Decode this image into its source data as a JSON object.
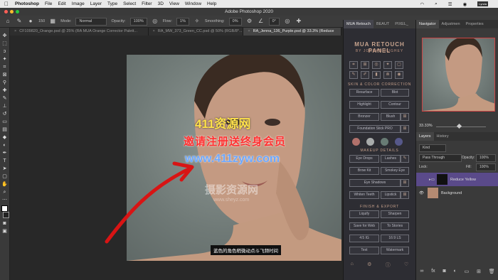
{
  "menubar": {
    "apple": "",
    "app": "Photoshop",
    "items": [
      "File",
      "Edit",
      "Image",
      "Layer",
      "Type",
      "Select",
      "Filter",
      "3D",
      "View",
      "Window",
      "Help"
    ],
    "right_icons": [
      "wifi-icon",
      "search-icon",
      "list-icon",
      "siri-icon",
      "lynda-icon"
    ]
  },
  "titlebar": {
    "title": "Adobe Photoshop 2020"
  },
  "options": {
    "size": "150",
    "mode_label": "Mode:",
    "mode_value": "Normal",
    "opacity_label": "Opacity:",
    "opacity_value": "100%",
    "flow_label": "Flow:",
    "flow_value": "1%",
    "smoothing_label": "Smoothing:",
    "smoothing_value": "0%",
    "angle_value": "0°"
  },
  "tabs": [
    {
      "label": "CF109820_Orange.psd @ 25% (RA MUA Orange Corrector Palett...",
      "active": false
    },
    {
      "label": "RA_MW_373_Green_CC.psd @ 50% (RGB/8*...",
      "active": false
    },
    {
      "label": "RA_Jenna_136_Purple.psd @ 33.3% (Reduce",
      "active": true
    }
  ],
  "watermarks": {
    "line1": "411资源网",
    "line2": "邀请注册送终身会员",
    "line3": "www.411zyw.com",
    "line4": "摄影资源网",
    "line5": "www.sheyz.com"
  },
  "subtitle": "蓝色的角色稍微动点斗飞频时间",
  "mua": {
    "tabs": [
      "MUA Retouch",
      "BEAUT",
      "PIXEL_"
    ],
    "title": "MUA RETOUCH PANEL",
    "subtitle": "BY JORDAN HUGHEY",
    "section_skin": "SKIN & COLOR CORRECTION",
    "skin_buttons": [
      "Resurface",
      "Blot",
      "Highlight",
      "Contour",
      "Bronzer",
      "Blush",
      "Foundation Stick PRO"
    ],
    "swatches": [
      "#b1716b",
      "#a8abab",
      "#687b74",
      "#56588a"
    ],
    "section_makeup": "MAKEUP DETAILS",
    "makeup_buttons": [
      "Eye Drops",
      "Lashes",
      "Brow Kit",
      "Smokey Eye",
      "Eye Shadows",
      "Whiten Teeth",
      "Lipstick"
    ],
    "section_finish": "FINISH & EXPORT",
    "finish_buttons": [
      "Liquify",
      "Sharpen",
      "Save for Web",
      "To Stories",
      "4:5 IG",
      "16:9 LS",
      "Text",
      "Watermark"
    ]
  },
  "navigator": {
    "tabs": [
      "Navigator",
      "Adjustmen",
      "Properties"
    ],
    "zoom": "33.33%"
  },
  "layers": {
    "tabs": [
      "Layers",
      "History"
    ],
    "filter": "Kind",
    "blend": "Pass Through",
    "opacity_label": "Opacity:",
    "opacity_value": "100%",
    "lock_label": "Lock:",
    "fill_label": "Fill:",
    "fill_value": "100%",
    "items": [
      {
        "name": "Reduce Yellow",
        "selected": true
      },
      {
        "name": "Background",
        "selected": false
      }
    ]
  }
}
